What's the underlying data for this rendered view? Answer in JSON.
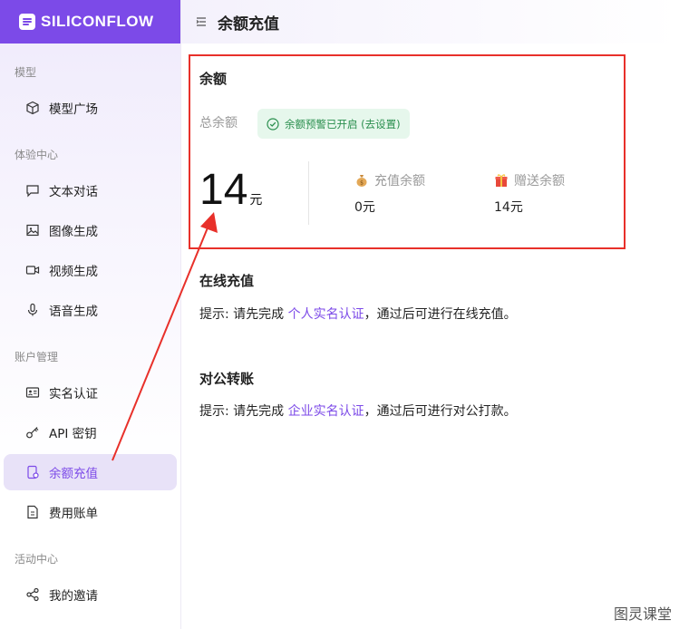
{
  "brand": {
    "name": "SILICONFLOW",
    "color": "#7c4ae8"
  },
  "header": {
    "title": "余额充值",
    "menu_icon": "collapse-menu-icon"
  },
  "sidebar": {
    "sections": [
      {
        "label": "模型"
      },
      {
        "label": "体验中心"
      },
      {
        "label": "账户管理"
      },
      {
        "label": "活动中心"
      }
    ],
    "items": [
      {
        "label": "模型广场",
        "icon": "cube-icon"
      },
      {
        "label": "文本对话",
        "icon": "chat-icon"
      },
      {
        "label": "图像生成",
        "icon": "image-icon"
      },
      {
        "label": "视频生成",
        "icon": "video-icon"
      },
      {
        "label": "语音生成",
        "icon": "mic-icon"
      },
      {
        "label": "实名认证",
        "icon": "id-card-icon"
      },
      {
        "label": "API 密钥",
        "icon": "key-icon"
      },
      {
        "label": "余额充值",
        "icon": "wallet-icon",
        "active": true
      },
      {
        "label": "费用账单",
        "icon": "bill-icon"
      },
      {
        "label": "我的邀请",
        "icon": "share-icon"
      }
    ]
  },
  "balance": {
    "title": "余额",
    "total_label": "总余额",
    "warning_badge": "余额预警已开启 (去设置)",
    "total_amount": "14",
    "unit": "元",
    "recharge_label": "充值余额",
    "recharge_value": "0元",
    "gift_label": "赠送余额",
    "gift_value": "14元"
  },
  "online": {
    "title": "在线充值",
    "hint_prefix": "提示: 请先完成 ",
    "hint_link": "个人实名认证",
    "hint_suffix": "，通过后可进行在线充值。"
  },
  "corporate": {
    "title": "对公转账",
    "hint_prefix": "提示: 请先完成 ",
    "hint_link": "企业实名认证",
    "hint_suffix": "，通过后可进行对公打款。"
  },
  "watermark": "图灵课堂",
  "colors": {
    "accent": "#7c4ae8",
    "highlight_border": "#e8302a",
    "success": "#2a8f4e"
  }
}
